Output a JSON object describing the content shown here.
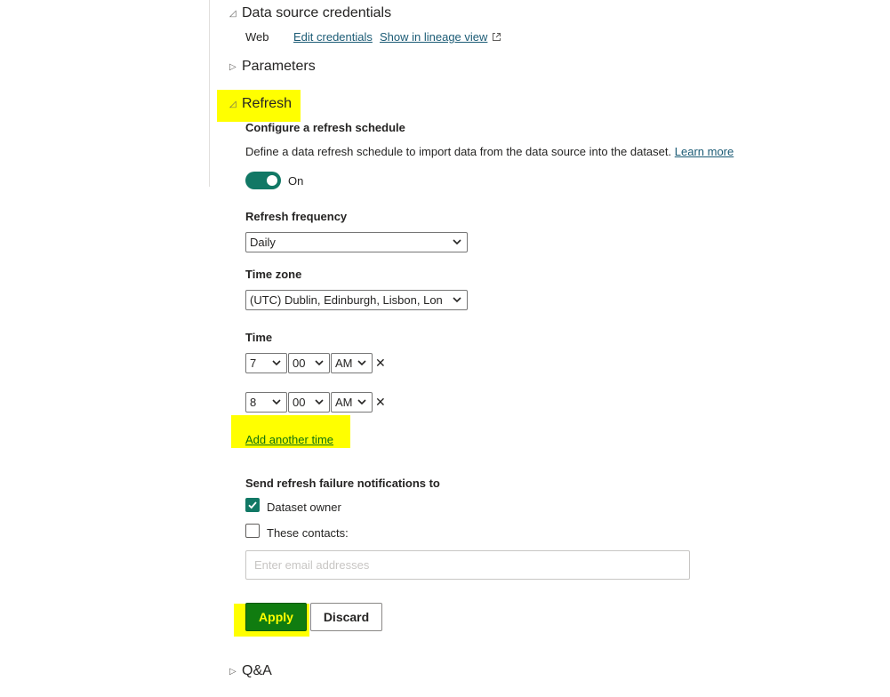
{
  "sections": {
    "credentials": {
      "title": "Data source credentials",
      "expanded": true,
      "source_type": "Web",
      "edit_link": "Edit credentials",
      "lineage_link": "Show in lineage view"
    },
    "parameters": {
      "title": "Parameters",
      "expanded": false
    },
    "refresh": {
      "title": "Refresh",
      "expanded": true
    },
    "qna": {
      "title": "Q&A",
      "expanded": false
    }
  },
  "refresh": {
    "configure_heading": "Configure a refresh schedule",
    "description": "Define a data refresh schedule to import data from the data source into the dataset.",
    "learn_more": "Learn more",
    "toggle_state": true,
    "toggle_label": "On",
    "frequency_label": "Refresh frequency",
    "frequency_value": "Daily",
    "timezone_label": "Time zone",
    "timezone_value": "(UTC) Dublin, Edinburgh, Lisbon, Lon",
    "time_label": "Time",
    "times": [
      {
        "hour": "7",
        "minute": "00",
        "period": "AM"
      },
      {
        "hour": "8",
        "minute": "00",
        "period": "AM"
      }
    ],
    "remove_glyph": "✕",
    "add_time": "Add another time",
    "notify_label": "Send refresh failure notifications to",
    "notify_owner": {
      "label": "Dataset owner",
      "checked": true
    },
    "notify_contacts": {
      "label": "These contacts:",
      "checked": false
    },
    "email_placeholder": "Enter email addresses",
    "apply_label": "Apply",
    "discard_label": "Discard"
  },
  "colors": {
    "accent": "#117865",
    "apply_bg": "#107c10",
    "apply_text": "#ffff00",
    "highlight": "#ffff00",
    "link": "#1b5b75"
  },
  "icons": {
    "expanded": "triangle-down-left-icon",
    "collapsed": "triangle-right-icon",
    "external": "external-link-icon",
    "dropdown": "chevron-down-icon",
    "remove": "close-icon",
    "check": "checkmark-icon"
  }
}
